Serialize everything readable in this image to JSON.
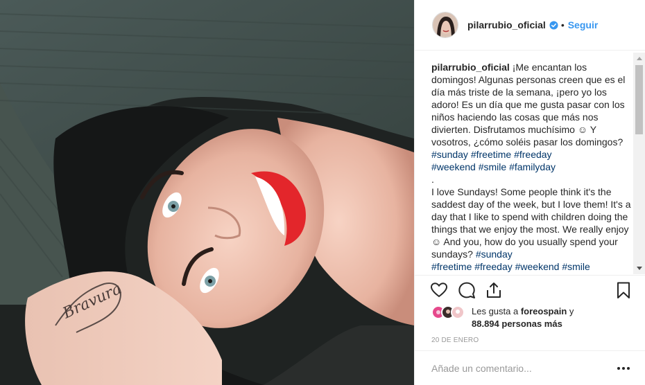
{
  "post": {
    "image_alt": "",
    "tattoo_text": "Bravura"
  },
  "header": {
    "username": "pilarrubio_oficial",
    "verified": true,
    "separator": "•",
    "follow_label": "Seguir"
  },
  "caption": {
    "username": "pilarrubio_oficial",
    "parts": [
      " ¡Me encantan los domingos! Algunas personas creen que es el día más triste de la semana, ¡pero yo los adoro! Es un día que me gusta pasar con los niños haciendo las cosas que más nos divierten. Disfrutamos muchísimo ☺ Y vosotros, ¿cómo soléis pasar los domingos? ",
      "#sunday",
      " ",
      "#freetime",
      " ",
      "#freeday",
      "\n",
      "#weekend",
      " ",
      "#smile",
      " ",
      "#familyday",
      "\n.\n",
      "I love Sundays! Some people think it's the saddest day of the week, but I love them! It's a day that I like to spend with children doing the things that we enjoy the most. We really enjoy ☺ And you, how do you usually spend your sundays? ",
      "#sunday",
      "\n",
      "#freetime",
      " ",
      "#freeday",
      " ",
      "#weekend",
      " ",
      "#smile"
    ]
  },
  "actions": {
    "like_icon": "heart-icon",
    "comment_icon": "comment-icon",
    "share_icon": "share-icon",
    "save_icon": "bookmark-icon"
  },
  "likes": {
    "prefix": "Les gusta a ",
    "user": "foreospain",
    "middle": " y",
    "count": "88.894 personas más"
  },
  "date": "20 DE ENERO",
  "comment": {
    "placeholder": "Añade un comentario...",
    "more_icon": "more-options-icon"
  },
  "colors": {
    "accent": "#3897f0",
    "hashtag": "#003569",
    "verified": "#3897f0",
    "border": "#efefef"
  }
}
